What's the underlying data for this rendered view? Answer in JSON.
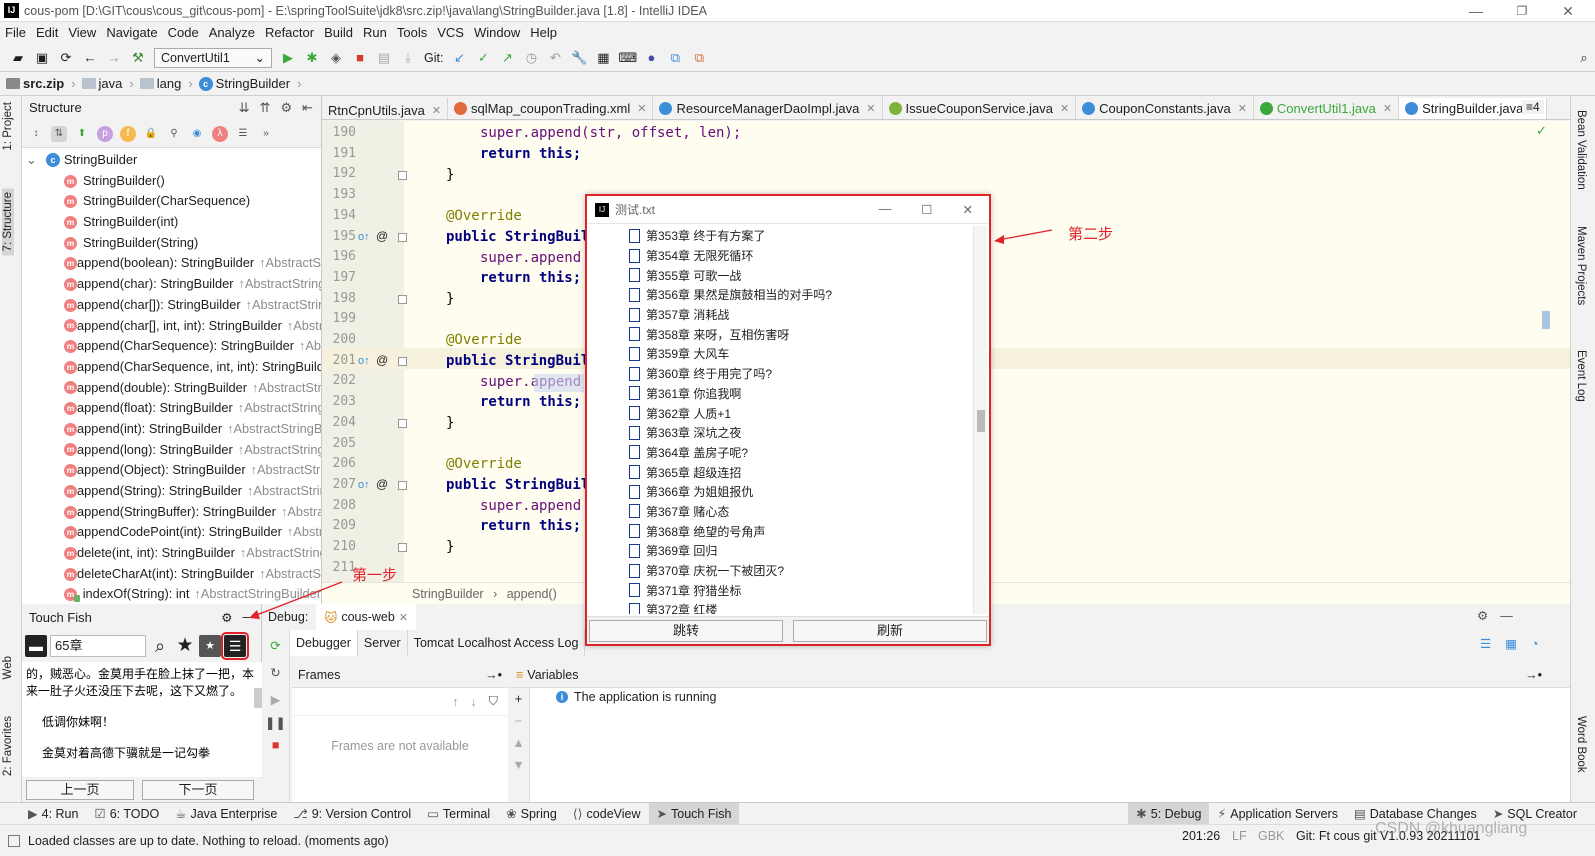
{
  "window": {
    "title": "cous-pom [D:\\GIT\\cous\\cous_git\\cous-pom] - E:\\springToolSuite\\jdk8\\src.zip!\\java\\lang\\StringBuilder.java [1.8] - IntelliJ IDEA",
    "logo": "IJ"
  },
  "menu": [
    "File",
    "Edit",
    "View",
    "Navigate",
    "Code",
    "Analyze",
    "Refactor",
    "Build",
    "Run",
    "Tools",
    "VCS",
    "Window",
    "Help"
  ],
  "toolbar": {
    "run_config": "ConvertUtil1",
    "git_label": "Git:"
  },
  "breadcrumb": [
    "src.zip",
    "java",
    "lang",
    "StringBuilder"
  ],
  "left_stripe": {
    "project": "1: Project",
    "structure": "7: Structure",
    "web": "Web",
    "favorites": "2: Favorites"
  },
  "right_stripe": {
    "bean": "Bean Validation",
    "maven": "Maven Projects",
    "event": "Event Log",
    "word": "Word Book"
  },
  "structure": {
    "title": "Structure",
    "root": "StringBuilder",
    "items": [
      {
        "name": "StringBuilder()",
        "suffix": ""
      },
      {
        "name": "StringBuilder(CharSequence)",
        "suffix": ""
      },
      {
        "name": "StringBuilder(int)",
        "suffix": ""
      },
      {
        "name": "StringBuilder(String)",
        "suffix": ""
      },
      {
        "name": "append(boolean): StringBuilder",
        "suffix": "↑AbstractStringBuilder"
      },
      {
        "name": "append(char): StringBuilder",
        "suffix": "↑AbstractStringBuilder"
      },
      {
        "name": "append(char[]): StringBuilder",
        "suffix": "↑AbstractStringBuilder"
      },
      {
        "name": "append(char[], int, int): StringBuilder",
        "suffix": "↑AbstractStringBuilder"
      },
      {
        "name": "append(CharSequence): StringBuilder",
        "suffix": "↑AbstractStringBuilder"
      },
      {
        "name": "append(CharSequence, int, int): StringBuilder",
        "suffix": ""
      },
      {
        "name": "append(double): StringBuilder",
        "suffix": "↑AbstractStringBuilder"
      },
      {
        "name": "append(float): StringBuilder",
        "suffix": "↑AbstractStringBuilder"
      },
      {
        "name": "append(int): StringBuilder",
        "suffix": "↑AbstractStringBuilder"
      },
      {
        "name": "append(long): StringBuilder",
        "suffix": "↑AbstractStringBuilder"
      },
      {
        "name": "append(Object): StringBuilder",
        "suffix": "↑AbstractStringBuilder"
      },
      {
        "name": "append(String): StringBuilder",
        "suffix": "↑AbstractStringBuilder"
      },
      {
        "name": "append(StringBuffer): StringBuilder",
        "suffix": "↑AbstractStringBuilder"
      },
      {
        "name": "appendCodePoint(int): StringBuilder",
        "suffix": "↑AbstractStringBuilder"
      },
      {
        "name": "delete(int, int): StringBuilder",
        "suffix": "↑AbstractStringBuilder"
      },
      {
        "name": "deleteCharAt(int): StringBuilder",
        "suffix": "↑AbstractStringBuilder"
      },
      {
        "name": "indexOf(String): int",
        "suffix": "↑AbstractStringBuilder"
      }
    ]
  },
  "tabs": [
    {
      "label": "RtnCpnUtils.java",
      "active": false
    },
    {
      "label": "sqlMap_couponTrading.xml",
      "active": false
    },
    {
      "label": "ResourceManagerDaoImpl.java",
      "active": false
    },
    {
      "label": "IssueCouponService.java",
      "active": false
    },
    {
      "label": "CouponConstants.java",
      "active": false
    },
    {
      "label": "ConvertUtil1.java",
      "active": false
    },
    {
      "label": "StringBuilder.java",
      "active": true
    }
  ],
  "tab_overflow": "≡4",
  "editor": {
    "lines": [
      "190",
      "191",
      "192",
      "193",
      "194",
      "195",
      "196",
      "197",
      "198",
      "199",
      "200",
      "201",
      "202",
      "203",
      "204",
      "205",
      "206",
      "207",
      "208",
      "209",
      "210",
      "211"
    ],
    "code": {
      "l190": "super.append(str, offset, len);",
      "l191": "return this;",
      "l192": "}",
      "l194": "@Override",
      "l195": "public StringBuilder",
      "l196": "super.append",
      "l197": "return this;",
      "l198": "}",
      "l200": "@Override",
      "l201": "public StringBuilder",
      "l202": "super.append",
      "l203": "return this;",
      "l204": "}",
      "l206": "@Override",
      "l207": "public StringBuilder",
      "l208": "super.append",
      "l209": "return this;",
      "l210": "}"
    },
    "breadcrumb": [
      "StringBuilder",
      "append()"
    ]
  },
  "touchfish": {
    "title": "Touch Fish",
    "search_value": "65章",
    "text": [
      "的，贼恶心。金莫用手在脸上抹了一把，本来一肚子火还没压下去呢，这下又燃了。",
      "低调你妹啊！",
      "金莫对着高德下骥就是一记勾拳"
    ],
    "prev": "上一页",
    "next": "下一页"
  },
  "debug": {
    "label": "Debug:",
    "session": "cous-web",
    "tabs": [
      "Debugger",
      "Server",
      "Tomcat Localhost Access Log"
    ],
    "frames_title": "Frames",
    "frames_empty": "Frames are not available",
    "vars_title": "Variables",
    "running": "The application is running"
  },
  "popup": {
    "title": "测试.txt",
    "chapters": [
      "第353章 终于有方案了",
      "第354章 无限死循环",
      "第355章 可歌一战",
      "第356章 果然是旗鼓相当的对手吗?",
      "第357章 消耗战",
      "第358章 来呀，互相伤害呀",
      "第359章 大风车",
      "第360章 终于用完了吗?",
      "第361章 你追我啊",
      "第362章 人质+1",
      "第363章 深坑之夜",
      "第364章 盖房子呢?",
      "第365章 超级连招",
      "第366章 为姐姐报仇",
      "第367章 赌心态",
      "第368章 绝望的号角声",
      "第369章 回归",
      "第370章 庆祝一下被团灭?",
      "第371章 狩猎坐标",
      "第372章 红楼"
    ],
    "jump": "跳转",
    "refresh": "刷新"
  },
  "annotations": {
    "step1": "第一步",
    "step2": "第二步"
  },
  "bottom_tabs": [
    {
      "label": "4: Run",
      "active": false
    },
    {
      "label": "6: TODO",
      "active": false
    },
    {
      "label": "Java Enterprise",
      "active": false
    },
    {
      "label": "9: Version Control",
      "active": false
    },
    {
      "label": "Terminal",
      "active": false
    },
    {
      "label": "Spring",
      "active": false
    },
    {
      "label": "codeView",
      "active": false
    },
    {
      "label": "Touch Fish",
      "active": true
    }
  ],
  "bottom_right_tabs": [
    {
      "label": "5: Debug"
    },
    {
      "label": "Application Servers"
    },
    {
      "label": "Database Changes"
    },
    {
      "label": "SQL Creator"
    }
  ],
  "status": {
    "message": "Loaded classes are up to date. Nothing to reload. (moments ago)",
    "position": "201:26",
    "line_sep": "LF",
    "encoding": "GBK",
    "git": "Git: Ft cous git V1.0.93 20211101",
    "watermark": "CSDN @khuangliang"
  },
  "colors": {
    "accent": "#4083c9",
    "annotation": "#e0232a",
    "editor_bg": "#fffdf0",
    "keyword": "#000080",
    "annotation_kw": "#808000"
  }
}
